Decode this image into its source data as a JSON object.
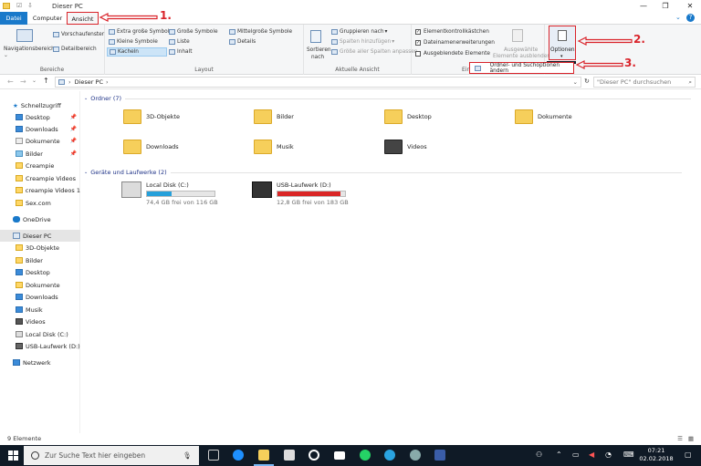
{
  "window": {
    "title": "Dieser PC",
    "min": "—",
    "max": "❐",
    "close": "✕",
    "help": "?"
  },
  "tabs": [
    {
      "label": "Datei"
    },
    {
      "label": "Computer"
    },
    {
      "label": "Ansicht"
    }
  ],
  "ribbon": {
    "bereiche": {
      "navigationsbereich": "Navigationsbereich",
      "vorschaufenster": "Vorschaufenster",
      "detailbereich": "Detailbereich",
      "label": "Bereiche"
    },
    "layout": {
      "items": [
        "Extra große Symbole",
        "Große Symbole",
        "Mittelgroße Symbole",
        "Kleine Symbole",
        "Liste",
        "Details",
        "Kacheln",
        "Inhalt"
      ],
      "label": "Layout"
    },
    "ansicht": {
      "sortieren": "Sortieren",
      "sortieren2": "nach",
      "gruppieren": "Gruppieren nach",
      "spalten": "Spalten hinzufügen",
      "groesse": "Größe aller Spalten anpassen",
      "label": "Aktuelle Ansicht"
    },
    "einblenden": {
      "elementkontrollkaestchen": "Elementkontrollkästchen",
      "dateinamenerweiterungen": "Dateinamenerweiterungen",
      "ausgeblendete": "Ausgeblendete Elemente",
      "ausgewaehlte": "Ausgewählte",
      "ausgewaehlte2": "Elemente ausblenden",
      "label": "Ein"
    },
    "optionen": {
      "label": "Optionen",
      "menu": "Ordner- und Suchoptionen ändern"
    }
  },
  "address": {
    "path": "Dieser PC",
    "search_placeholder": "\"Dieser PC\" durchsuchen"
  },
  "nav": [
    {
      "label": "Schnellzugriff",
      "pin": false
    },
    {
      "label": "Desktop",
      "pin": true
    },
    {
      "label": "Downloads",
      "pin": true
    },
    {
      "label": "Dokumente",
      "pin": true
    },
    {
      "label": "Bilder",
      "pin": true
    },
    {
      "label": "Creampie",
      "pin": false
    },
    {
      "label": "Creampie Videos",
      "pin": false
    },
    {
      "label": "creampie Videos 1",
      "pin": false
    },
    {
      "label": "Sex.com",
      "pin": false
    },
    {
      "label": "OneDrive",
      "pin": false
    },
    {
      "label": "Dieser PC",
      "pin": false
    },
    {
      "label": "3D-Objekte",
      "pin": false
    },
    {
      "label": "Bilder",
      "pin": false
    },
    {
      "label": "Desktop",
      "pin": false
    },
    {
      "label": "Dokumente",
      "pin": false
    },
    {
      "label": "Downloads",
      "pin": false
    },
    {
      "label": "Musik",
      "pin": false
    },
    {
      "label": "Videos",
      "pin": false
    },
    {
      "label": "Local Disk (C:)",
      "pin": false
    },
    {
      "label": "USB-Laufwerk (D:)",
      "pin": false
    },
    {
      "label": "Netzwerk",
      "pin": false
    }
  ],
  "folders_header": "Ordner (7)",
  "folders": [
    {
      "label": "3D-Objekte"
    },
    {
      "label": "Bilder"
    },
    {
      "label": "Desktop"
    },
    {
      "label": "Dokumente"
    },
    {
      "label": "Downloads"
    },
    {
      "label": "Musik"
    },
    {
      "label": "Videos"
    }
  ],
  "drives_header": "Geräte und Laufwerke (2)",
  "drives": [
    {
      "label": "Local Disk (C:)",
      "free": "74,4 GB frei von 116 GB",
      "used_fraction": 0.36,
      "color": "#26a0da"
    },
    {
      "label": "USB-Laufwerk (D:)",
      "free": "12,8 GB frei von 183 GB",
      "used_fraction": 0.93,
      "color": "#da2626"
    }
  ],
  "status": "9 Elemente",
  "taskbar": {
    "search": "Zur Suche Text hier eingeben",
    "time": "07:21",
    "date": "02.02.2018"
  },
  "annotations": [
    "1.",
    "2.",
    "3."
  ]
}
